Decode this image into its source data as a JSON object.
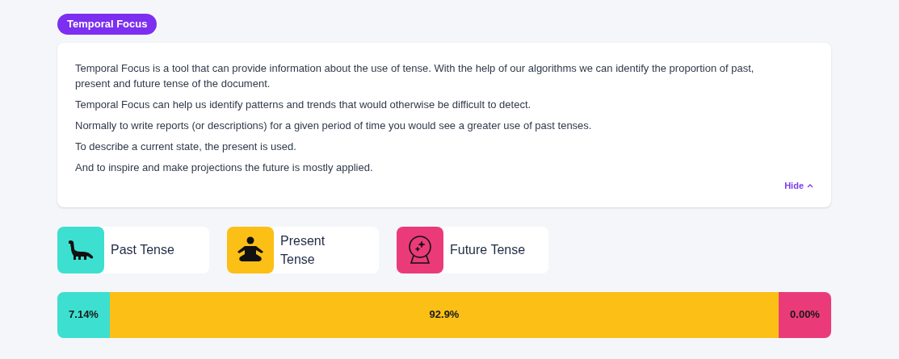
{
  "badge": "Temporal Focus",
  "description": {
    "paragraphs": [
      "Temporal Focus is a tool that can provide information about the use of tense. With the help of our algorithms we can identify the proportion of past, present and future tense of the document.",
      "Temporal Focus can help us identify patterns and trends that would otherwise be difficult to detect.",
      "Normally to write reports (or descriptions) for a given period of time you would see a greater use of past tenses.",
      "To describe a current state, the present is used.",
      "And to inspire and make projections the future is mostly applied."
    ],
    "toggle": "Hide"
  },
  "legend": [
    {
      "kind": "past",
      "label": "Past Tense",
      "color": "#3ddfd0"
    },
    {
      "kind": "present",
      "label": "Present Tense",
      "color": "#fbbf16"
    },
    {
      "kind": "future",
      "label": "Future Tense",
      "color": "#ea3b78"
    }
  ],
  "bar": [
    {
      "reading": "7.14%",
      "color": "#3ddfd0"
    },
    {
      "reading": "92.9%",
      "color": "#fbbf16"
    },
    {
      "reading": "0.00%",
      "color": "#ea3b78"
    }
  ]
}
